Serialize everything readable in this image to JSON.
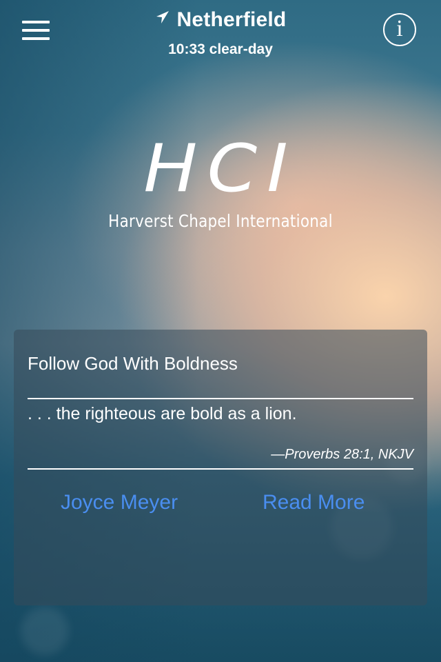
{
  "header": {
    "menu_icon": "hamburger-menu-icon",
    "location_icon": "location-arrow-icon",
    "location": "Netherfield",
    "weather_line": "10:33 clear-day",
    "info_icon": "info-icon",
    "info_glyph": "i"
  },
  "logo": {
    "mark": "HCI",
    "name": "Harverst Chapel International"
  },
  "devotional": {
    "title": "Follow God With Boldness",
    "verse": ". . . the righteous are bold as a lion.",
    "reference": "—Proverbs 28:1, NKJV",
    "author_link": "Joyce Meyer",
    "read_more_link": "Read More"
  },
  "colors": {
    "link": "#4a8ef0",
    "text": "#ffffff"
  }
}
